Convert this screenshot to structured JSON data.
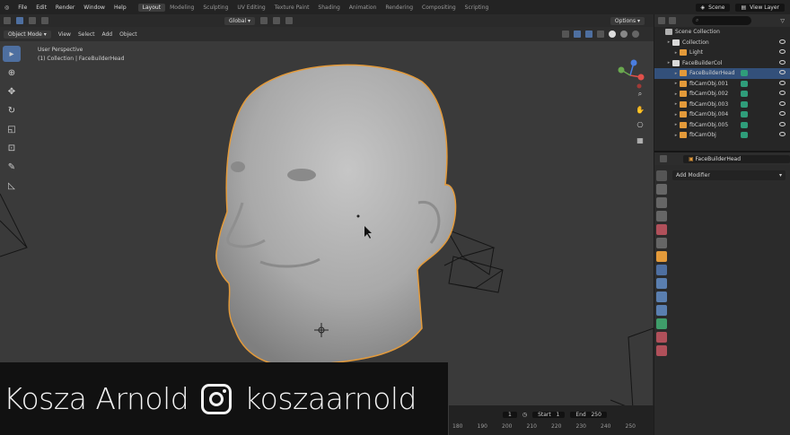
{
  "menu": [
    "File",
    "Edit",
    "Render",
    "Window",
    "Help"
  ],
  "workspaces": [
    "Layout",
    "Modeling",
    "Sculpting",
    "UV Editing",
    "Texture Paint",
    "Shading",
    "Animation",
    "Rendering",
    "Compositing",
    "Scripting"
  ],
  "active_workspace": "Layout",
  "scene_field": "Scene",
  "view_layer_field": "View Layer",
  "viewport_header": {
    "transform": "Global",
    "options": "Options"
  },
  "viewport_header2": {
    "mode": "Object Mode",
    "items": [
      "View",
      "Select",
      "Add",
      "Object"
    ]
  },
  "viewport": {
    "perspective": "User Perspective",
    "collection_info": "(1) Collection | FaceBuilderHead"
  },
  "tools": [
    {
      "name": "select-box-icon",
      "glyph": "▸"
    },
    {
      "name": "cursor-icon",
      "glyph": "⊕"
    },
    {
      "name": "move-icon",
      "glyph": "✥"
    },
    {
      "name": "rotate-icon",
      "glyph": "↻"
    },
    {
      "name": "scale-icon",
      "glyph": "◱"
    },
    {
      "name": "transform-icon",
      "glyph": "⊡"
    },
    {
      "name": "annotate-icon",
      "glyph": "✎"
    },
    {
      "name": "measure-icon",
      "glyph": "◺"
    }
  ],
  "nav_buttons": [
    {
      "name": "zoom-icon",
      "glyph": "⌕"
    },
    {
      "name": "pan-icon",
      "glyph": "✋"
    },
    {
      "name": "camera-icon",
      "glyph": "⎔"
    },
    {
      "name": "grid-icon",
      "glyph": "▦"
    }
  ],
  "timeline": {
    "frame": "1",
    "start_label": "Start",
    "start": "1",
    "end_label": "End",
    "end": "250",
    "ticks": [
      "180",
      "190",
      "200",
      "210",
      "220",
      "230",
      "240",
      "250"
    ]
  },
  "overlay": {
    "name": "Kosza Arnold",
    "handle": "koszaarnold"
  },
  "outliner": {
    "rows": [
      {
        "label": "Scene Collection",
        "indent": 0,
        "icon": "#b0b0b0",
        "sel": false,
        "eye": false,
        "ext": false
      },
      {
        "label": "Collection",
        "indent": 1,
        "icon": "#d9d9d9",
        "sel": false,
        "eye": true,
        "ext": false
      },
      {
        "label": "Light",
        "indent": 2,
        "icon": "#e39a3a",
        "sel": false,
        "eye": true,
        "ext": false
      },
      {
        "label": "FaceBuilderCol",
        "indent": 1,
        "icon": "#d9d9d9",
        "sel": false,
        "eye": true,
        "ext": false
      },
      {
        "label": "FaceBuilderHead",
        "indent": 2,
        "icon": "#e39a3a",
        "sel": true,
        "eye": true,
        "ext": true
      },
      {
        "label": "fbCamObj.001",
        "indent": 2,
        "icon": "#e39a3a",
        "sel": false,
        "eye": true,
        "ext": true
      },
      {
        "label": "fbCamObj.002",
        "indent": 2,
        "icon": "#e39a3a",
        "sel": false,
        "eye": true,
        "ext": true
      },
      {
        "label": "fbCamObj.003",
        "indent": 2,
        "icon": "#e39a3a",
        "sel": false,
        "eye": true,
        "ext": true
      },
      {
        "label": "fbCamObj.004",
        "indent": 2,
        "icon": "#e39a3a",
        "sel": false,
        "eye": true,
        "ext": true
      },
      {
        "label": "fbCamObj.005",
        "indent": 2,
        "icon": "#e39a3a",
        "sel": false,
        "eye": true,
        "ext": true
      },
      {
        "label": "fbCamObj",
        "indent": 2,
        "icon": "#e39a3a",
        "sel": false,
        "eye": true,
        "ext": true
      }
    ]
  },
  "properties": {
    "object": "FaceBuilderHead",
    "add_modifier": "Add Modifier"
  },
  "colors": {
    "accent": "#4e6fa0",
    "selection": "#e39a3a",
    "viewport": "#3a3a3a"
  }
}
